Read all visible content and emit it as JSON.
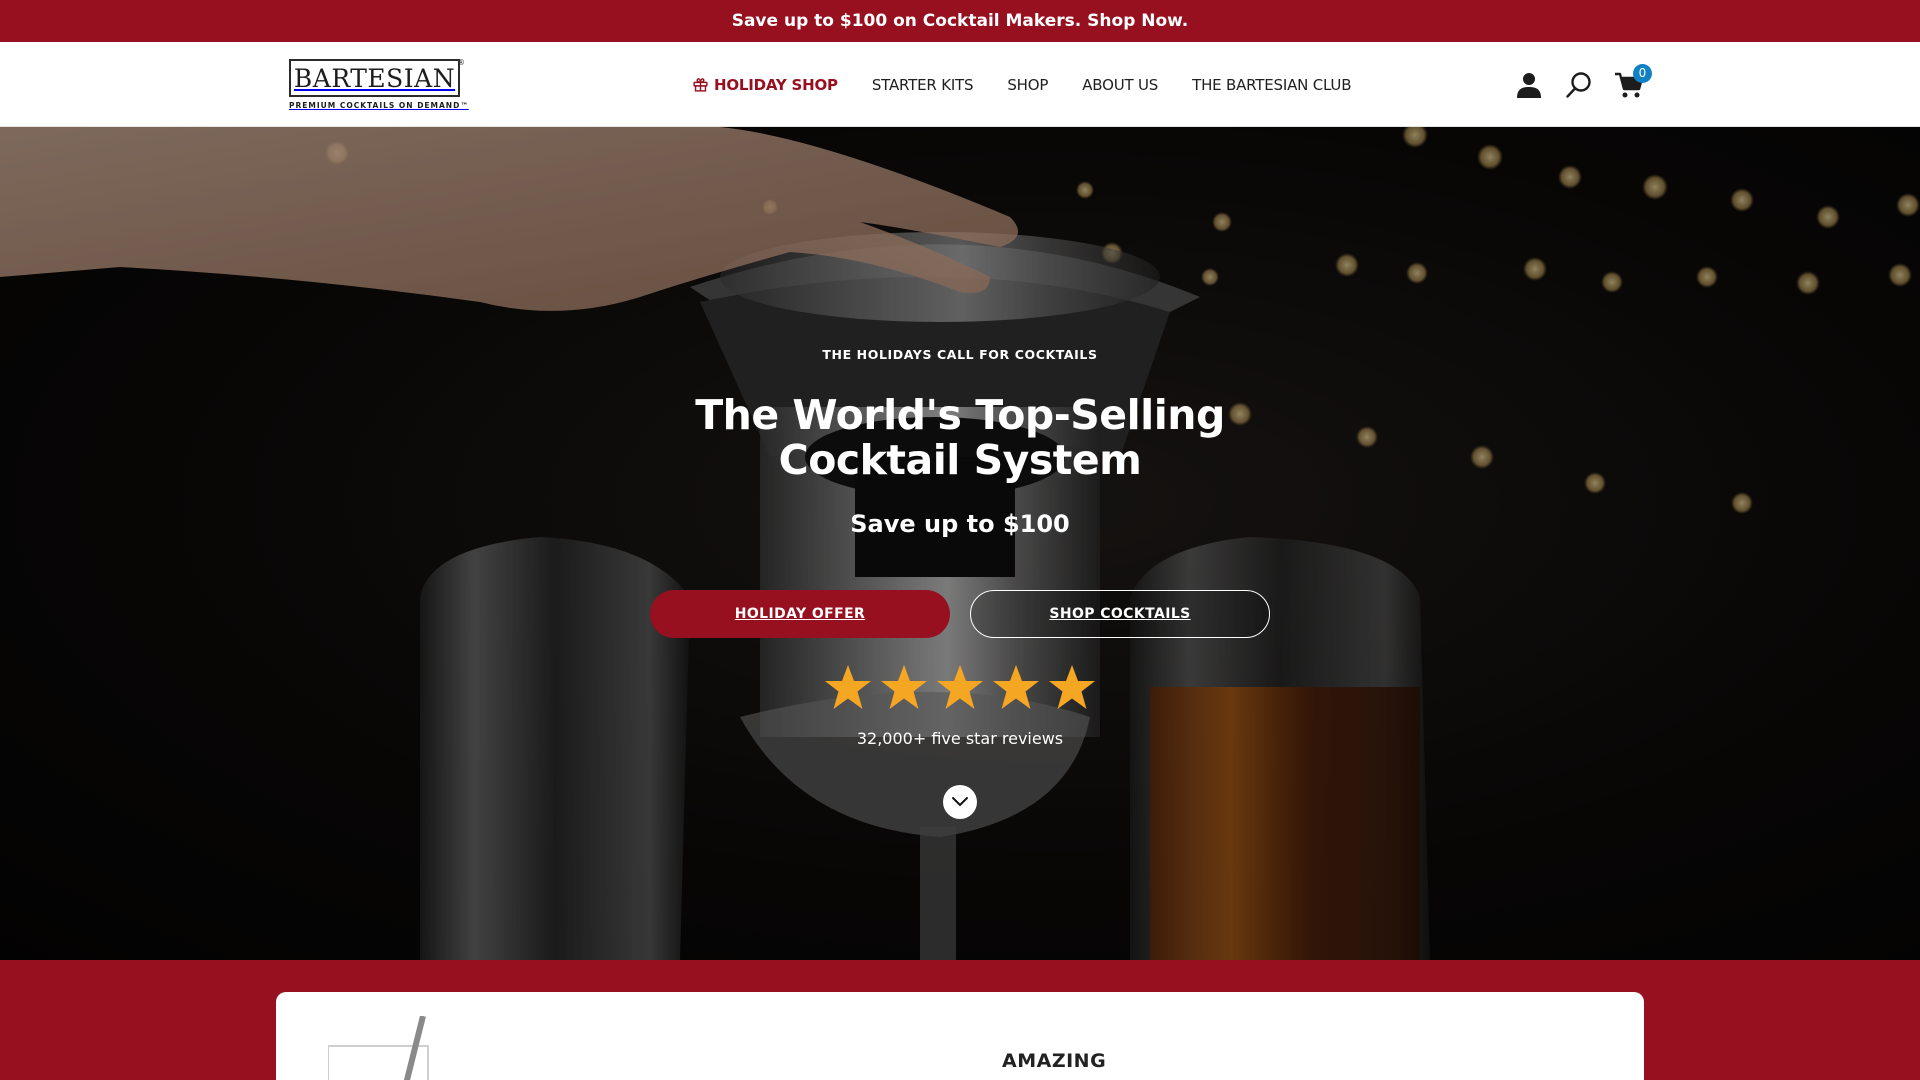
{
  "announcement": {
    "text": "Save up to $100 on Cocktail Makers. Shop Now."
  },
  "brand": {
    "name": "BARTESIAN",
    "tagline": "PREMIUM COCKTAILS ON DEMAND™",
    "reg": "®"
  },
  "nav": {
    "items": [
      {
        "label": "HOLIDAY SHOP",
        "icon": "gift-icon",
        "highlight": true
      },
      {
        "label": "STARTER KITS"
      },
      {
        "label": "SHOP"
      },
      {
        "label": "ABOUT US"
      },
      {
        "label": "THE BARTESIAN CLUB"
      }
    ]
  },
  "header_icons": {
    "account": "account-icon",
    "search": "search-icon",
    "cart": "cart-icon",
    "cart_count": "0"
  },
  "hero": {
    "eyebrow": "THE HOLIDAYS CALL FOR COCKTAILS",
    "headline": "The World's Top-Selling Cocktail System",
    "subhead": "Save up to $100",
    "primary_button": "HOLIDAY OFFER",
    "secondary_button": "SHOP COCKTAILS",
    "rating_stars": 5,
    "reviews_text": "32,000+ five star reviews"
  },
  "section": {
    "title": "AMAZING"
  },
  "colors": {
    "brand_red": "#971020",
    "star": "#f5a623",
    "badge_blue": "#1281c4"
  }
}
